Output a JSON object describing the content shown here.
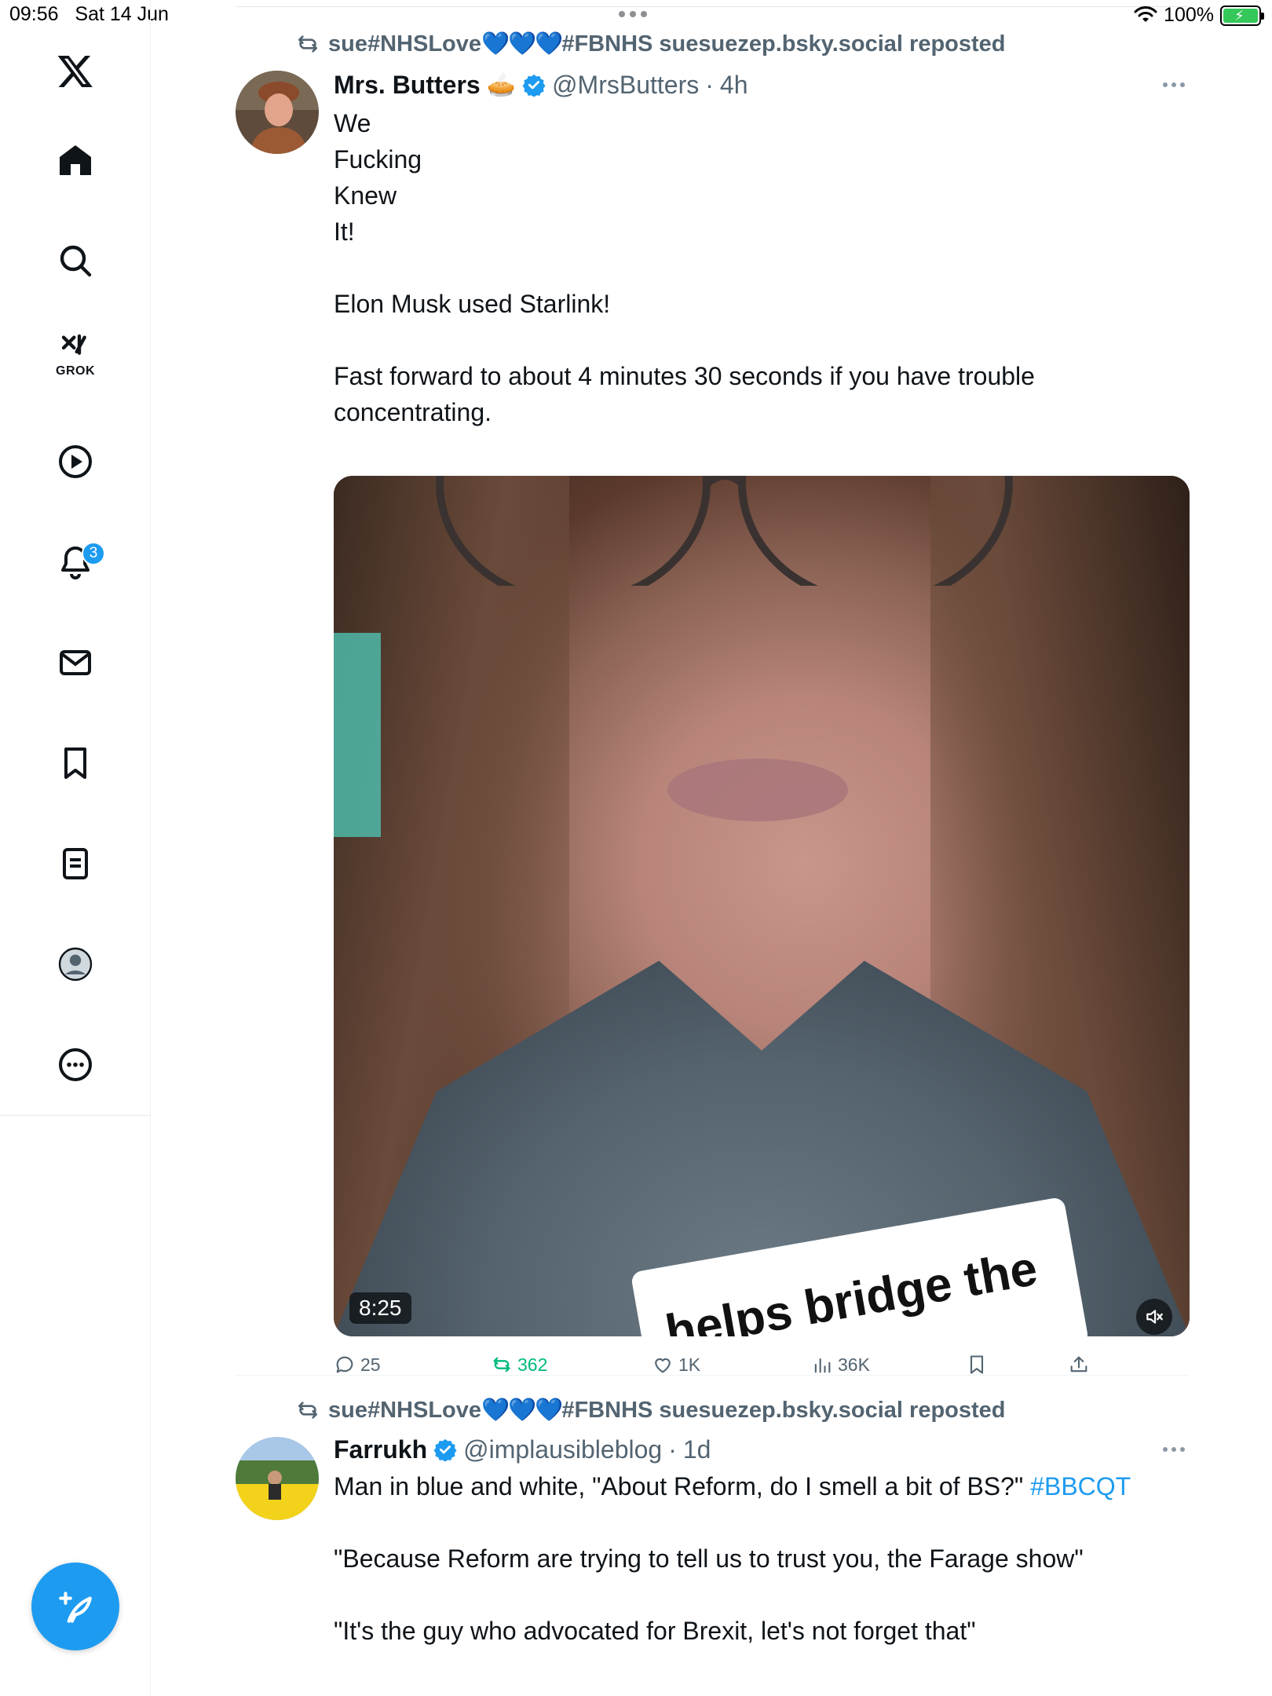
{
  "status_bar": {
    "time": "09:56",
    "date": "Sat 14 Jun",
    "battery_percent": "100%"
  },
  "sidebar": {
    "logo": "x-logo-icon",
    "items": [
      {
        "name": "home",
        "icon": "home-icon"
      },
      {
        "name": "explore",
        "icon": "search-icon"
      },
      {
        "name": "grok",
        "icon": "grok-icon",
        "label": "GROK"
      },
      {
        "name": "video",
        "icon": "play-circle-icon"
      },
      {
        "name": "notifications",
        "icon": "bell-icon",
        "badge": "3"
      },
      {
        "name": "messages",
        "icon": "mail-icon"
      },
      {
        "name": "bookmarks",
        "icon": "bookmark-icon"
      },
      {
        "name": "lists",
        "icon": "list-icon"
      },
      {
        "name": "profile",
        "icon": "avatar-icon"
      },
      {
        "name": "more",
        "icon": "more-circle-icon"
      }
    ],
    "compose_icon": "compose-icon"
  },
  "colors": {
    "accent": "#1d9bf0",
    "retweet_green": "#00ba7c",
    "muted_text": "#536471",
    "primary_text": "#0f1419"
  },
  "posts": [
    {
      "repost_by": "sue#NHSLove",
      "repost_hearts": "💙💙💙",
      "repost_suffix": "#FBNHS suesuezep.bsky.social reposted",
      "display_name": "Mrs. Butters",
      "name_emoji": "🥧",
      "verified": true,
      "handle": "@MrsButters",
      "separator": "·",
      "time": "4h",
      "text_lines": [
        "We",
        "Fucking",
        "Knew",
        "It!",
        "",
        "Elon Musk used Starlink!",
        "",
        "Fast forward to about 4 minutes 30 seconds if you have trouble",
        "concentrating."
      ],
      "media": {
        "type": "video",
        "duration": "8:25",
        "caption_overlay": "helps bridge the"
      },
      "actions": {
        "replies": "25",
        "reposts": "362",
        "likes": "1K",
        "views": "36K"
      }
    },
    {
      "repost_by": "sue#NHSLove",
      "repost_hearts": "💙💙💙",
      "repost_suffix": "#FBNHS suesuezep.bsky.social reposted",
      "display_name": "Farrukh",
      "verified": true,
      "handle": "@implausibleblog",
      "separator": "·",
      "time": "1d",
      "text_line_1": "Man in blue and white, \"About Reform, do I smell a bit of BS?\"",
      "hashtag": "#BBCQT",
      "text_line_2": "\"Because Reform are trying to tell us to trust you, the Farage show\"",
      "text_line_3": "\"It's the guy who advocated for Brexit, let's not forget that\""
    }
  ]
}
